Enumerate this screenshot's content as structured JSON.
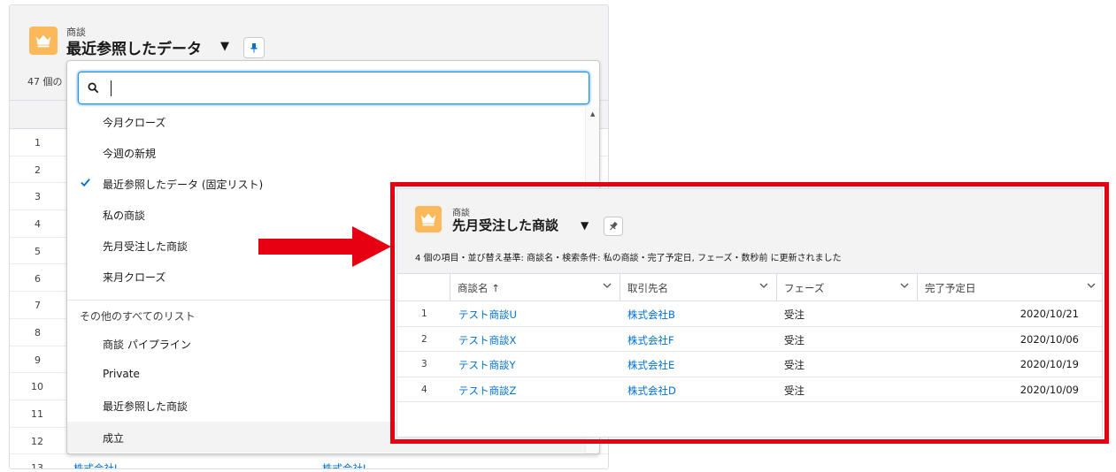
{
  "left_panel": {
    "object_label": "商談",
    "list_title": "最近参照したデータ",
    "count_text": "47 個の",
    "row_numbers": [
      "1",
      "2",
      "3",
      "4",
      "5",
      "6",
      "7",
      "8",
      "9",
      "10",
      "11",
      "12",
      "13"
    ],
    "row13_account": "株式会社J-",
    "row13_account2": "株式会社J"
  },
  "dropdown": {
    "search_placeholder": "",
    "search_value": "",
    "items": [
      {
        "label": "今月クローズ"
      },
      {
        "label": "今週の新規"
      },
      {
        "label": "最近参照したデータ (固定リスト)"
      },
      {
        "label": "私の商談"
      },
      {
        "label": "先月受注した商談"
      },
      {
        "label": "来月クローズ"
      }
    ],
    "section_label": "その他のすべてのリスト",
    "other_items": [
      {
        "label": "商談 パイプライン"
      },
      {
        "label": "Private"
      },
      {
        "label": "最近参照した商談"
      },
      {
        "label": "成立"
      }
    ]
  },
  "right_panel": {
    "object_label": "商談",
    "list_title": "先月受注した商談",
    "status_text": "4 個の項目・並び替え基準: 商談名・検索条件: 私の商談・完了予定日, フェーズ・数秒前 に更新されました",
    "columns": [
      {
        "label": "商談名 ↑"
      },
      {
        "label": "取引先名"
      },
      {
        "label": "フェーズ"
      },
      {
        "label": "完了予定日"
      }
    ],
    "rows": [
      {
        "num": "1",
        "name": "テスト商談U",
        "account": "株式会社B",
        "stage": "受注",
        "close_date": "2020/10/21"
      },
      {
        "num": "2",
        "name": "テスト商談X",
        "account": "株式会社F",
        "stage": "受注",
        "close_date": "2020/10/06"
      },
      {
        "num": "3",
        "name": "テスト商談Y",
        "account": "株式会社E",
        "stage": "受注",
        "close_date": "2020/10/19"
      },
      {
        "num": "4",
        "name": "テスト商談Z",
        "account": "株式会社D",
        "stage": "受注",
        "close_date": "2020/10/09"
      }
    ]
  },
  "colors": {
    "accent": "#0070d2",
    "object_icon": "#fcb95b",
    "highlight": "#e60012",
    "arrow": "#e60012"
  },
  "icons": {
    "object": "crown-icon",
    "pin": "pin-icon",
    "search": "search-icon",
    "check": "check-icon",
    "chevron": "chevron-down-icon"
  }
}
